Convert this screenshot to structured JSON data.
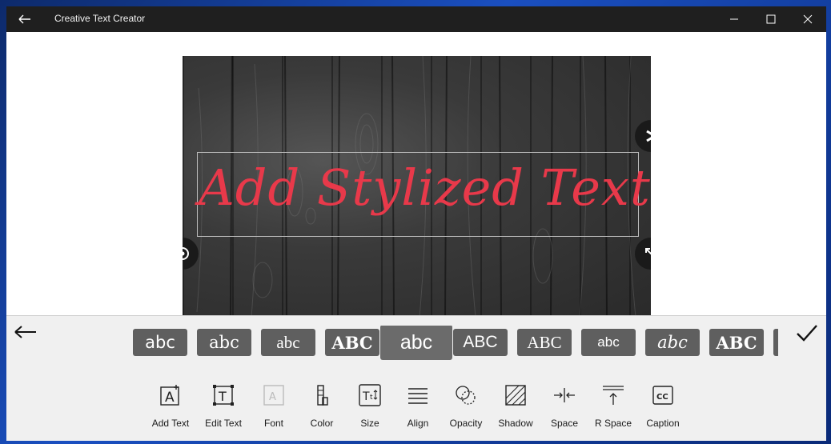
{
  "window": {
    "title": "Creative Text Creator"
  },
  "canvas": {
    "text": "Add Stylized Text",
    "text_color": "#e8394a"
  },
  "style_presets": [
    "abc",
    "abc",
    "abc",
    "ABC",
    "abc",
    "ABC",
    "ABC",
    "abc",
    "abc",
    "ABC"
  ],
  "selected_style_index": 4,
  "tools": [
    {
      "label": "Add Text",
      "icon": "add-text-icon"
    },
    {
      "label": "Edit Text",
      "icon": "edit-text-icon"
    },
    {
      "label": "Font",
      "icon": "font-icon"
    },
    {
      "label": "Color",
      "icon": "color-icon"
    },
    {
      "label": "Size",
      "icon": "size-icon"
    },
    {
      "label": "Align",
      "icon": "align-icon"
    },
    {
      "label": "Opacity",
      "icon": "opacity-icon"
    },
    {
      "label": "Shadow",
      "icon": "shadow-icon"
    },
    {
      "label": "Space",
      "icon": "space-icon"
    },
    {
      "label": "R Space",
      "icon": "row-space-icon"
    },
    {
      "label": "Caption",
      "icon": "caption-icon"
    }
  ]
}
